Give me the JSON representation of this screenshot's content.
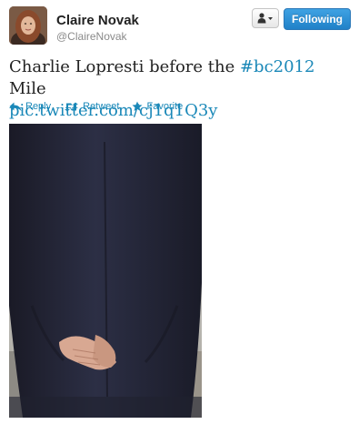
{
  "user": {
    "name": "Claire Novak",
    "handle": "@ClaireNovak"
  },
  "buttons": {
    "user_menu_icon": "person-dropdown-icon",
    "follow_label": "Following"
  },
  "tweet": {
    "text_before": "Charlie Lopresti before the ",
    "hashtag": "#bc2012",
    "text_after": " Mile",
    "link": "pic.twitter.com/cj1q1Q3y"
  },
  "actions": {
    "reply": "Reply",
    "retweet": "Retweet",
    "favorite": "Favorite"
  },
  "colors": {
    "link": "#1a88b8",
    "follow_button": "#2a8fd6",
    "text": "#222222",
    "handle": "#8a8a8a"
  }
}
